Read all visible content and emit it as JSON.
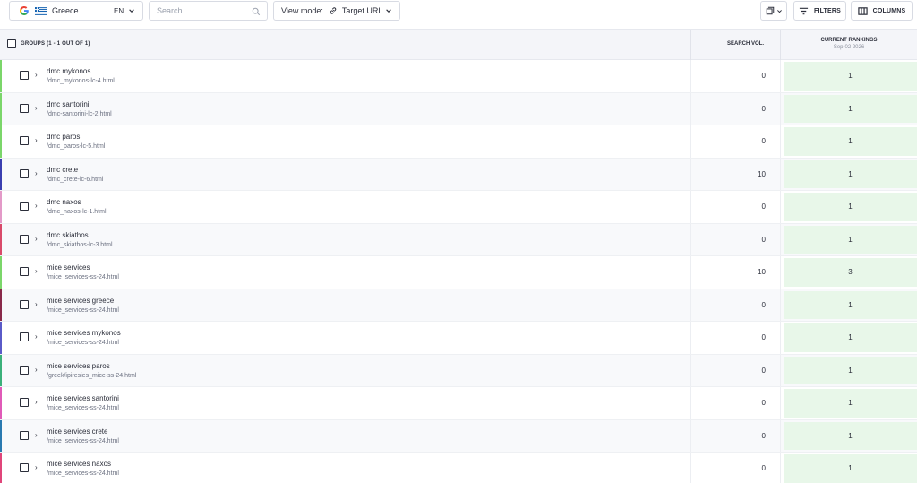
{
  "toolbar": {
    "country": "Greece",
    "language": "EN",
    "search_placeholder": "Search",
    "view_mode_label": "View mode:",
    "view_mode_value": "Target URL",
    "filters_label": "FILTERS",
    "columns_label": "COLUMNS"
  },
  "table": {
    "groups_header": "GROUPS (1 - 1 OUT OF 1)",
    "search_vol_header": "SEARCH VOL.",
    "rankings_header": "CURRENT RANKINGS",
    "rankings_date": "Sep-02 2026",
    "rows": [
      {
        "keyword": "dmc mykonos",
        "url": "/dmc_mykonos-lc-4.html",
        "search_vol": "0",
        "rank": "1",
        "color": "#7bd66a"
      },
      {
        "keyword": "dmc santorini",
        "url": "/dmc-santorini-lc-2.html",
        "search_vol": "0",
        "rank": "1",
        "color": "#7bd66a"
      },
      {
        "keyword": "dmc paros",
        "url": "/dmc_paros-lc-5.html",
        "search_vol": "0",
        "rank": "1",
        "color": "#7bd66a"
      },
      {
        "keyword": "dmc crete",
        "url": "/dmc_crete-lc-6.html",
        "search_vol": "10",
        "rank": "1",
        "color": "#3b3fb0"
      },
      {
        "keyword": "dmc naxos",
        "url": "/dmc_naxos-lc-1.html",
        "search_vol": "0",
        "rank": "1",
        "color": "#e39ac8"
      },
      {
        "keyword": "dmc skiathos",
        "url": "/dmc_skiathos-lc-3.html",
        "search_vol": "0",
        "rank": "1",
        "color": "#d94a6a"
      },
      {
        "keyword": "mice services",
        "url": "/mice_services-ss-24.html",
        "search_vol": "10",
        "rank": "3",
        "color": "#7bd66a"
      },
      {
        "keyword": "mice services greece",
        "url": "/mice_services-ss-24.html",
        "search_vol": "0",
        "rank": "1",
        "color": "#8a2a4a"
      },
      {
        "keyword": "mice services mykonos",
        "url": "/mice_services-ss-24.html",
        "search_vol": "0",
        "rank": "1",
        "color": "#5a5ac8"
      },
      {
        "keyword": "mice services paros",
        "url": "/greek/ipiresies_mice-ss-24.html",
        "search_vol": "0",
        "rank": "1",
        "color": "#3bb07a"
      },
      {
        "keyword": "mice services santorini",
        "url": "/mice_services-ss-24.html",
        "search_vol": "0",
        "rank": "1",
        "color": "#e05ab8"
      },
      {
        "keyword": "mice services crete",
        "url": "/mice_services-ss-24.html",
        "search_vol": "0",
        "rank": "1",
        "color": "#2a7ab0"
      },
      {
        "keyword": "mice services naxos",
        "url": "/mice_services-ss-24.html",
        "search_vol": "0",
        "rank": "1",
        "color": "#e0457a"
      }
    ]
  }
}
